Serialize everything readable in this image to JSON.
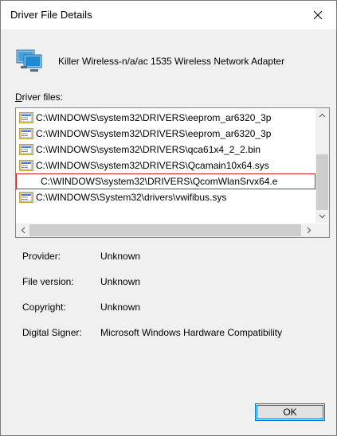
{
  "window": {
    "title": "Driver File Details",
    "close_icon": "close-icon"
  },
  "device": {
    "name": "Killer Wireless-n/a/ac 1535 Wireless Network Adapter",
    "icon": "network-adapter-icon"
  },
  "driver_files": {
    "label_prefix": "D",
    "label_rest": "river files:",
    "items": [
      {
        "path": "C:\\WINDOWS\\system32\\DRIVERS\\eeprom_ar6320_3p",
        "icon": "file-icon"
      },
      {
        "path": "C:\\WINDOWS\\system32\\DRIVERS\\eeprom_ar6320_3p",
        "icon": "file-icon"
      },
      {
        "path": "C:\\WINDOWS\\system32\\DRIVERS\\qca61x4_2_2.bin",
        "icon": "file-icon"
      },
      {
        "path": "C:\\WINDOWS\\system32\\DRIVERS\\Qcamain10x64.sys",
        "icon": "file-icon"
      },
      {
        "path": "C:\\WINDOWS\\system32\\DRIVERS\\QcomWlanSrvx64.e",
        "icon": "",
        "selected": true
      },
      {
        "path": "C:\\WINDOWS\\System32\\drivers\\vwifibus.sys",
        "icon": "file-icon"
      }
    ]
  },
  "details": {
    "provider_label": "Provider:",
    "provider_value": "Unknown",
    "version_label": "File version:",
    "version_value": "Unknown",
    "copyright_label": "Copyright:",
    "copyright_value": "Unknown",
    "signer_label": "Digital Signer:",
    "signer_value": "Microsoft Windows Hardware Compatibility"
  },
  "buttons": {
    "ok_label": "OK"
  },
  "colors": {
    "accent": "#0078d7",
    "selection_outline": "#d61d1d"
  }
}
